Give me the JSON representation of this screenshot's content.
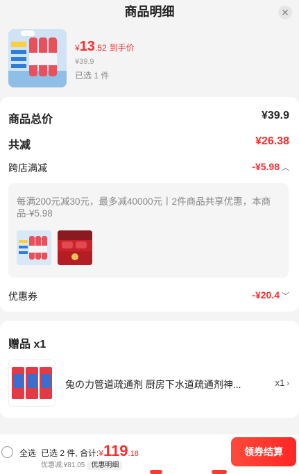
{
  "header": {
    "title": "商品明细",
    "close": "✕"
  },
  "product": {
    "price_currency": "¥",
    "price_int": "13",
    "price_dec": ".52",
    "price_tag": "到手价",
    "original_price": "¥39.9",
    "selected_count": "已选 1 件"
  },
  "summary": {
    "total_label": "商品总价",
    "total_value": "¥39.9",
    "reduce_label": "共减",
    "reduce_value": "¥26.38",
    "cross_store_label": "跨店满减",
    "cross_store_value": "-¥5.98",
    "promo_text": "每满200元减30元，最多减40000元丨2件商品共享优惠，本商品-¥5.98",
    "coupon_label": "优惠券",
    "coupon_value": "-¥20.4"
  },
  "gift": {
    "title": "赠品 x1",
    "name": "兔の力管道疏通剂 厨房下水道疏通剂神...",
    "qty": "x1"
  },
  "footer": {
    "select_all": "全选",
    "selected_summary": "已选 2 件, 合计:",
    "total_currency": "¥",
    "total_int": "119",
    "total_dec": ".18",
    "discount_text": "优惠减:¥81.05",
    "detail_button": "优惠明细",
    "checkout_button": "领券结算"
  },
  "colors": {
    "accent": "#ff2a2a",
    "background": "#f4f4f4",
    "card": "#ffffff"
  }
}
